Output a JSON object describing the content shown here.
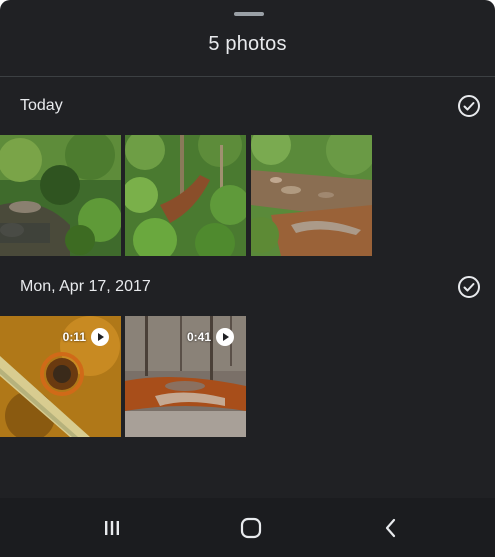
{
  "sheet": {
    "title": "5 photos"
  },
  "sections": [
    {
      "label": "Today",
      "items": [
        {
          "kind": "photo",
          "icon": "forest-stream-photo"
        },
        {
          "kind": "photo",
          "icon": "hillside-ravine-photo"
        },
        {
          "kind": "photo",
          "icon": "rocky-creek-photo"
        }
      ]
    },
    {
      "label": "Mon, Apr 17, 2017",
      "items": [
        {
          "kind": "video",
          "duration": "0:11",
          "icon": "rusty-pipe-video"
        },
        {
          "kind": "video",
          "duration": "0:41",
          "icon": "orange-creek-video"
        }
      ]
    }
  ],
  "icons": {
    "check": "check-circle-icon",
    "play": "play-icon",
    "nav_recents": "recents-icon",
    "nav_home": "home-icon",
    "nav_back": "back-icon"
  },
  "colors": {
    "background": "#202124",
    "text": "#e8eaed",
    "navbar": "#1b1c1f"
  }
}
